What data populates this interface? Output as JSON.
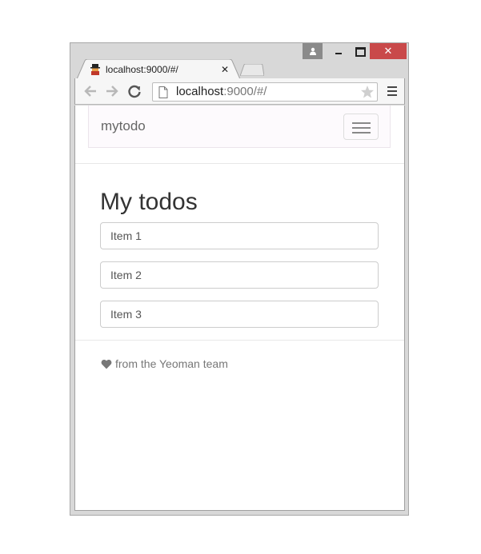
{
  "browser": {
    "tab_title": "localhost:9000/#/",
    "url_host": "localhost",
    "url_rest": ":9000/#/",
    "close_glyph": "✕",
    "tab_close_glyph": "✕"
  },
  "page": {
    "brand": "mytodo",
    "heading": "My todos",
    "todos": [
      "Item 1",
      "Item 2",
      "Item 3"
    ],
    "footer": "from the Yeoman team"
  },
  "icons": {
    "back": "arrow-left-icon",
    "forward": "arrow-right-icon",
    "reload": "reload-icon",
    "page": "page-icon",
    "star": "star-icon",
    "menu": "hamburger-menu-icon",
    "heart": "heart-icon",
    "favicon": "yeoman-favicon-icon",
    "user": "user-icon"
  },
  "colors": {
    "close_button": "#c9494a",
    "navbar_bg": "#fdfafd",
    "heading": "#333333",
    "footer_text": "#777777"
  }
}
